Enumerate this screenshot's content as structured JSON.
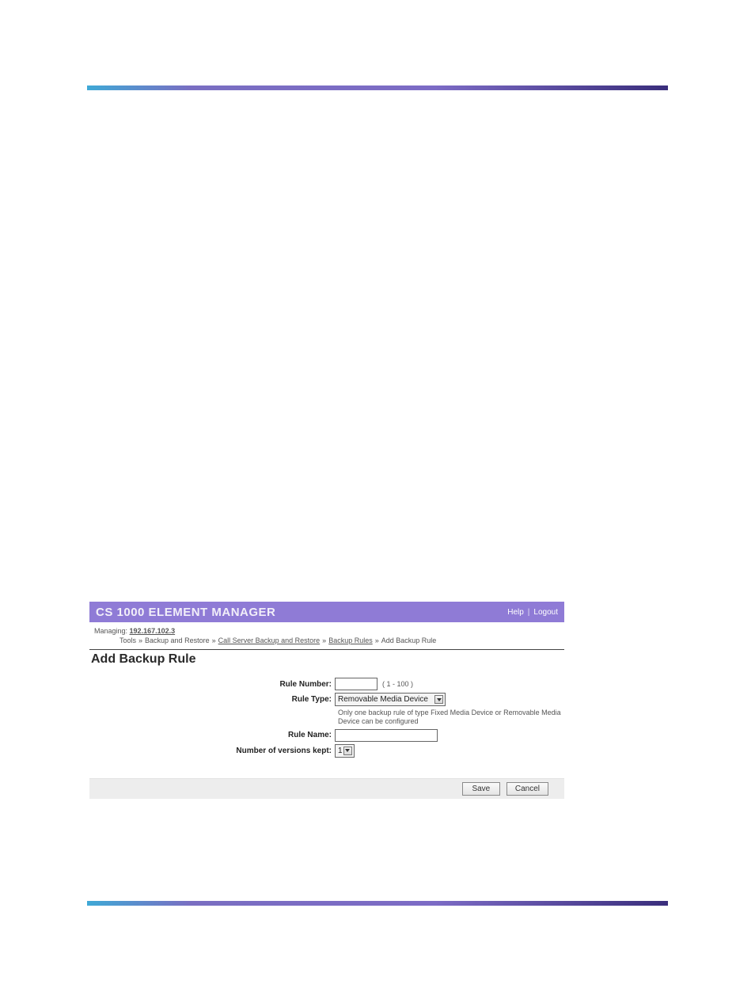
{
  "header": {
    "app_title": "CS 1000 ELEMENT MANAGER",
    "help_label": "Help",
    "logout_label": "Logout",
    "divider": "|"
  },
  "managing": {
    "label": "Managing:",
    "ip": "192.167.102.3"
  },
  "breadcrumb": {
    "sep": "»",
    "items": [
      {
        "label": "Tools",
        "link": false
      },
      {
        "label": "Backup and Restore",
        "link": false
      },
      {
        "label": "Call Server Backup and Restore",
        "link": true
      },
      {
        "label": "Backup Rules",
        "link": true
      },
      {
        "label": "Add Backup Rule",
        "link": false
      }
    ]
  },
  "section": {
    "title": "Add Backup Rule"
  },
  "form": {
    "rule_number": {
      "label": "Rule Number:",
      "value": "",
      "range": "( 1 - 100 )"
    },
    "rule_type": {
      "label": "Rule Type:",
      "selected": "Removable Media Device",
      "hint": "Only one backup rule of type Fixed Media Device or Removable Media Device can be configured"
    },
    "rule_name": {
      "label": "Rule Name:",
      "value": ""
    },
    "versions": {
      "label": "Number of versions kept:",
      "selected": "1"
    }
  },
  "buttons": {
    "save": "Save",
    "cancel": "Cancel"
  }
}
